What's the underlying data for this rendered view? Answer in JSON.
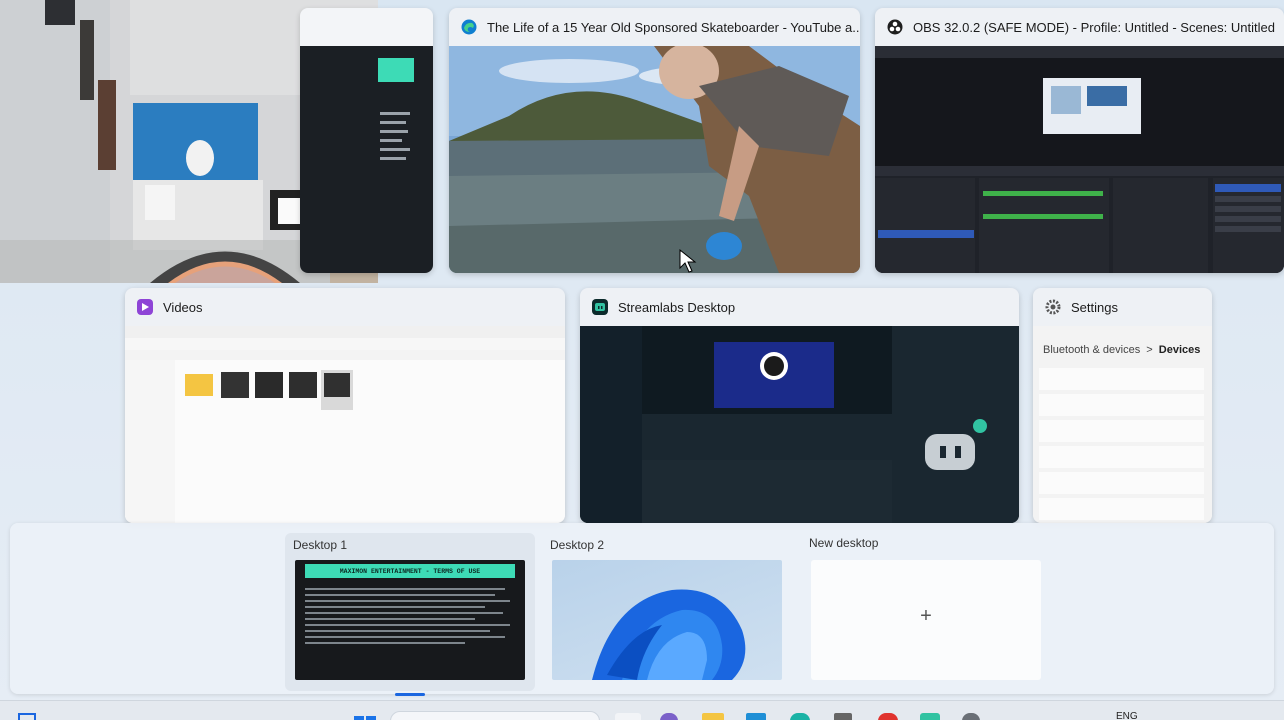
{
  "windows": [
    {
      "title": "The Life of a 15 Year Old Sponsored Skateboarder - YouTube a...",
      "icon": "edge-icon"
    },
    {
      "title": "OBS 32.0.2 (SAFE MODE) - Profile: Untitled - Scenes: Untitled",
      "icon": "obs-icon"
    },
    {
      "title": "Videos",
      "icon": "folder-icon"
    },
    {
      "title": "Streamlabs Desktop",
      "icon": "streamlabs-icon"
    },
    {
      "title": "Settings",
      "icon": "gear-icon"
    }
  ],
  "settings_thumb": {
    "breadcrumb_parent": "Bluetooth & devices",
    "breadcrumb_sep": ">",
    "breadcrumb_current": "Devices"
  },
  "desktops": [
    {
      "label": "Desktop 1",
      "active": true,
      "thumb_heading": "MAXIMON ENTERTAINMENT - TERMS OF USE"
    },
    {
      "label": "Desktop 2",
      "active": false
    },
    {
      "label": "New desktop",
      "action_glyph": "+"
    }
  ],
  "taskbar": {
    "language": "ENG"
  },
  "colors": {
    "accent_teal": "#3ddbb6",
    "obs_bg": "#1f2229",
    "streamlabs_bg": "#17242d",
    "win_blue": "#1a66e0"
  }
}
